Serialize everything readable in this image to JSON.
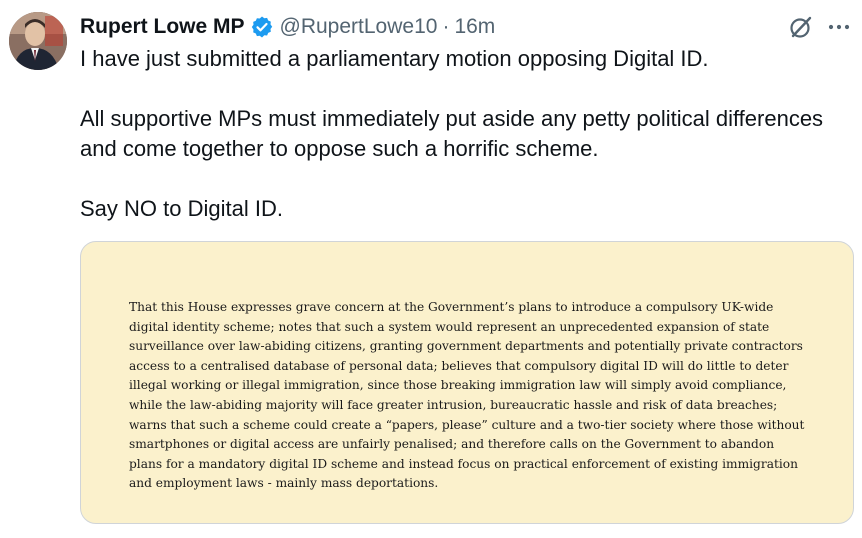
{
  "post": {
    "author": {
      "display_name": "Rupert Lowe MP",
      "handle": "@RupertLowe10",
      "verified": true
    },
    "separator": "·",
    "timestamp": "16m",
    "paragraphs": [
      "I have just submitted a parliamentary motion opposing Digital ID.",
      "All supportive MPs must immediately put aside any petty political differences and come together to oppose such a horrific scheme.",
      "Say NO to Digital ID."
    ],
    "attachment": {
      "background_color": "#fbf1cc",
      "motion_text": "That this House expresses grave concern at the Government’s plans to introduce a compulsory UK-wide digital identity scheme; notes that such a system would represent an unprecedented expansion of state surveillance over law-abiding citizens, granting government departments and potentially private contractors access to a centralised database of personal data; believes that compulsory digital ID will do little to deter illegal working or illegal immigration, since those breaking immigration law will simply avoid compliance, while the law-abiding majority will face greater intrusion, bureaucratic hassle and risk of data breaches; warns that such a scheme could create a “papers, please” culture and a two-tier society where those without smartphones or digital access are unfairly penalised; and therefore calls on the Government to abandon plans for a mandatory digital ID scheme and instead focus on practical enforcement of existing immigration and employment laws - mainly mass deportations."
    }
  },
  "icons": {
    "verified": "verified-badge-icon",
    "grok": "grok-icon",
    "more": "more-options-icon"
  },
  "colors": {
    "text_primary": "#0f1419",
    "text_secondary": "#536471",
    "verified_blue": "#1d9bf0"
  }
}
